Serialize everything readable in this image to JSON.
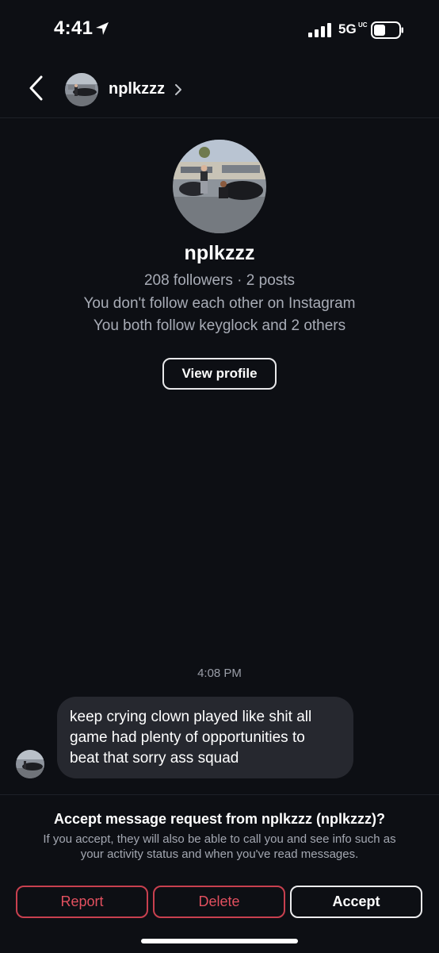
{
  "status_bar": {
    "time": "4:41",
    "network": "5G",
    "network_sub": "UC",
    "icons": [
      "location-arrow-icon",
      "cellular-signal-icon",
      "battery-icon"
    ]
  },
  "header": {
    "username": "nplkzzz",
    "icons": [
      "back-chevron-icon",
      "chevron-right-icon"
    ]
  },
  "profile": {
    "name": "nplkzzz",
    "stats": "208 followers · 2 posts",
    "follow_status": "You don't follow each other on Instagram",
    "mutuals": "You both follow keyglock and 2 others",
    "view_profile_label": "View profile"
  },
  "conversation": {
    "timestamp": "4:08 PM",
    "messages": [
      {
        "sender": "nplkzzz",
        "lines": [
          "keep crying clown played like shit all",
          "game had plenty of opportunities to",
          "beat that sorry ass squad"
        ]
      }
    ]
  },
  "request": {
    "title": "Accept message request from nplkzzz (nplkzzz)?",
    "description_lines": [
      "If you accept, they will also be able to call you and see info such as",
      "your activity status and when you've read messages."
    ],
    "buttons": {
      "report": "Report",
      "delete": "Delete",
      "accept": "Accept"
    }
  },
  "colors": {
    "background": "#0d0f14",
    "bubble": "#26282f",
    "secondary_text": "#a8acb6",
    "danger": "#e2505f",
    "divider": "#1e2128"
  }
}
